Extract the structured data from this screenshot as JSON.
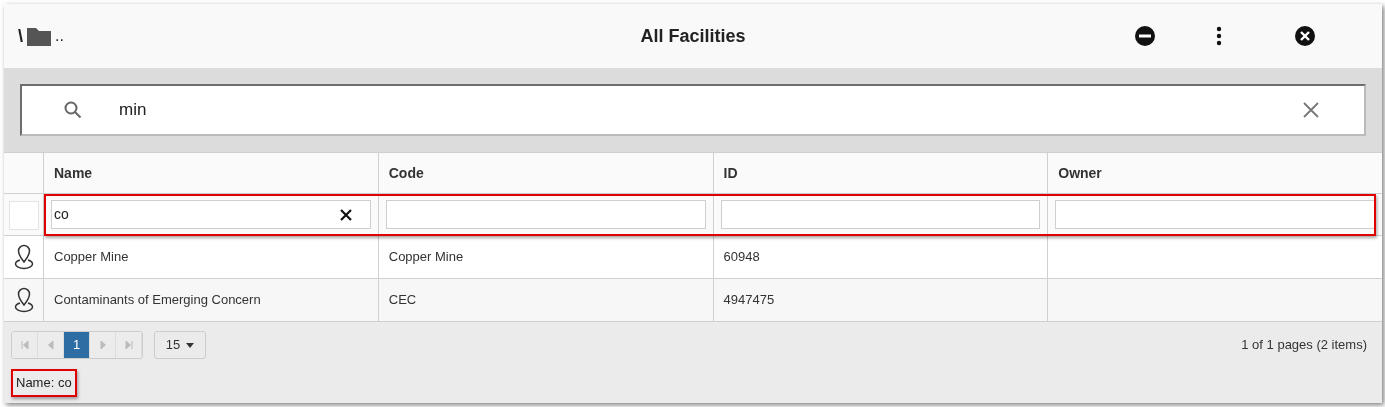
{
  "window": {
    "title": "All Facilities",
    "path_prefix": "\\",
    "path": ".."
  },
  "search": {
    "value": "min"
  },
  "table": {
    "filter_row_highlighted": true,
    "columns": [
      {
        "label": "Name",
        "filter": "co"
      },
      {
        "label": "Code"
      },
      {
        "label": "ID"
      },
      {
        "label": "Owner"
      }
    ],
    "rows": [
      {
        "cells": [
          "Copper Mine",
          "Copper Mine",
          "60948"
        ]
      },
      {
        "cells": [
          "Contaminants of Emerging Concern",
          "CEC",
          "4947475"
        ]
      }
    ]
  },
  "pager": {
    "nav": [
      {
        "kind": "first",
        "disabled": true
      },
      {
        "kind": "prev",
        "disabled": true
      }
    ],
    "pages": [
      {
        "label": "1",
        "selected": true
      }
    ],
    "nav_after": [
      {
        "kind": "next",
        "disabled": true
      },
      {
        "kind": "last",
        "disabled": true
      }
    ],
    "page_size": "15",
    "summary": "1 of 1 pages (2 items)"
  },
  "active_filter": {
    "text": "Name: co",
    "highlighted": true
  }
}
